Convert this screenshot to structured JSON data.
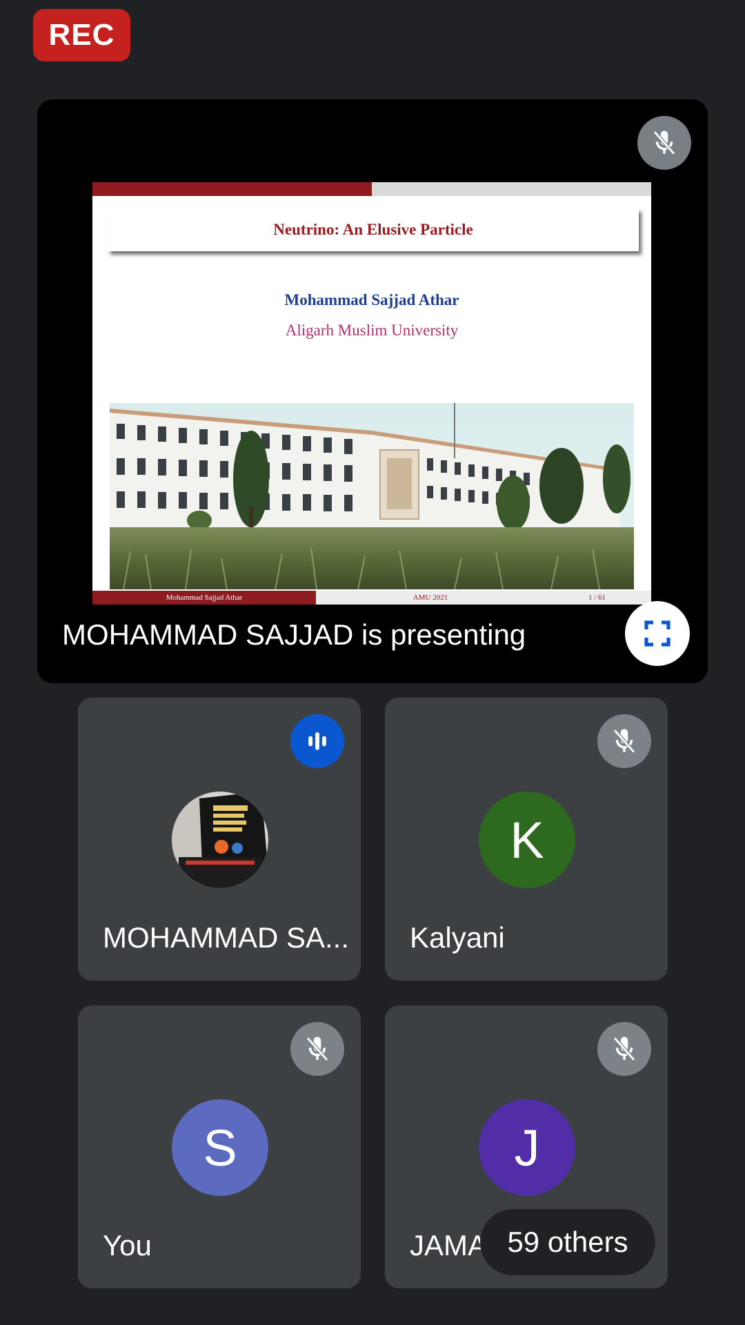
{
  "recording": {
    "label": "REC",
    "color": "#c5221f"
  },
  "presentation": {
    "status_text": "MOHAMMAD SAJJAD is presenting",
    "mic_icon": "mic-off-icon",
    "fullscreen_icon": "fullscreen-icon",
    "slide": {
      "title": "Neutrino: An Elusive Particle",
      "author": "Mohammad Sajjad Athar",
      "institution": "Aligarh Muslim University",
      "footer_left": "Mohammad Sajjad Athar",
      "footer_center": "AMU 2021",
      "footer_page": "1 / 61",
      "progress": 0.5,
      "accent_color": "#8e1b1f"
    }
  },
  "participants": [
    {
      "name": "MOHAMMAD SA...",
      "avatar_type": "photo",
      "status_icon": "speaking-icon",
      "status_color": "#0b57d0"
    },
    {
      "name": "Kalyani",
      "initial": "K",
      "avatar_color": "#2d6a1f",
      "status_icon": "mic-off-icon"
    },
    {
      "name": "You",
      "initial": "S",
      "avatar_color": "#5c6bc0",
      "status_icon": "mic-off-icon"
    },
    {
      "name": "JAMAL",
      "initial": "J",
      "avatar_color": "#512da8",
      "status_icon": "mic-off-icon"
    }
  ],
  "others": {
    "label": "59 others"
  }
}
